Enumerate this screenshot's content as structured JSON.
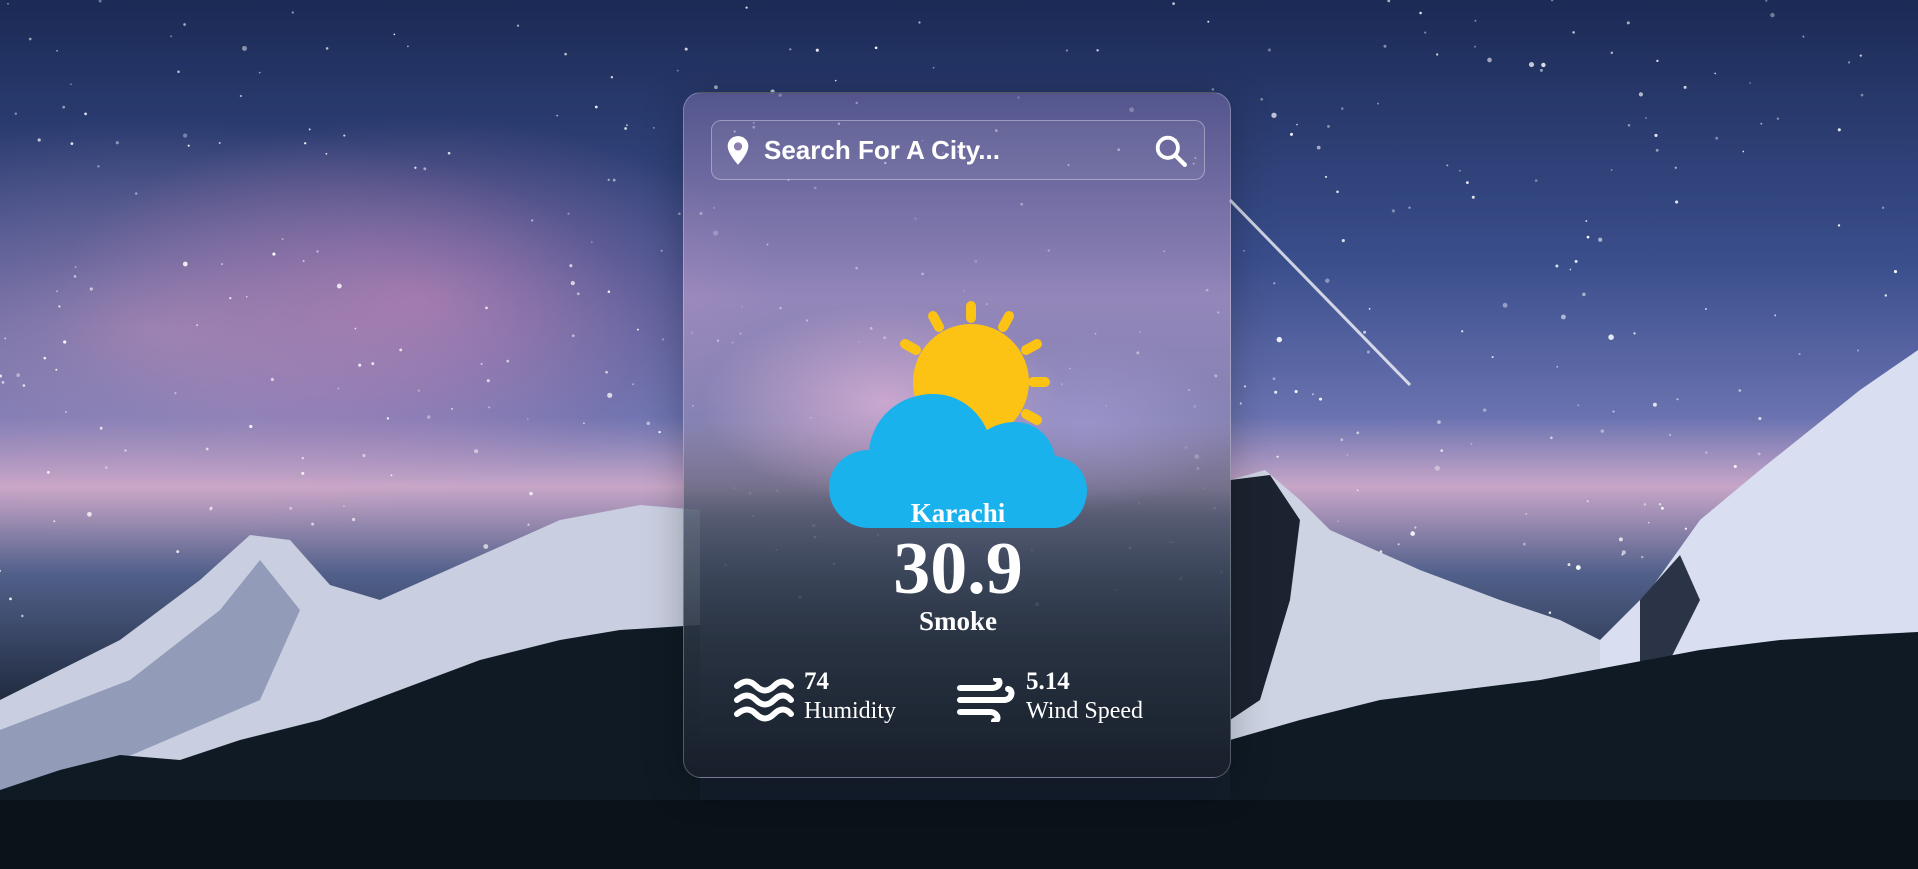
{
  "search": {
    "placeholder": "Search For A City..."
  },
  "weather": {
    "city": "Karachi",
    "temperature": "30.9",
    "condition": "Smoke",
    "icon": "sun-behind-cloud-icon"
  },
  "stats": {
    "humidity": {
      "value": "74",
      "label": "Humidity",
      "icon": "waves-icon"
    },
    "wind": {
      "value": "5.14",
      "label": "Wind Speed",
      "icon": "wind-icon"
    }
  },
  "colors": {
    "sun": "#FCC214",
    "cloud": "#1AB2EC",
    "text": "#FFFFFF"
  }
}
